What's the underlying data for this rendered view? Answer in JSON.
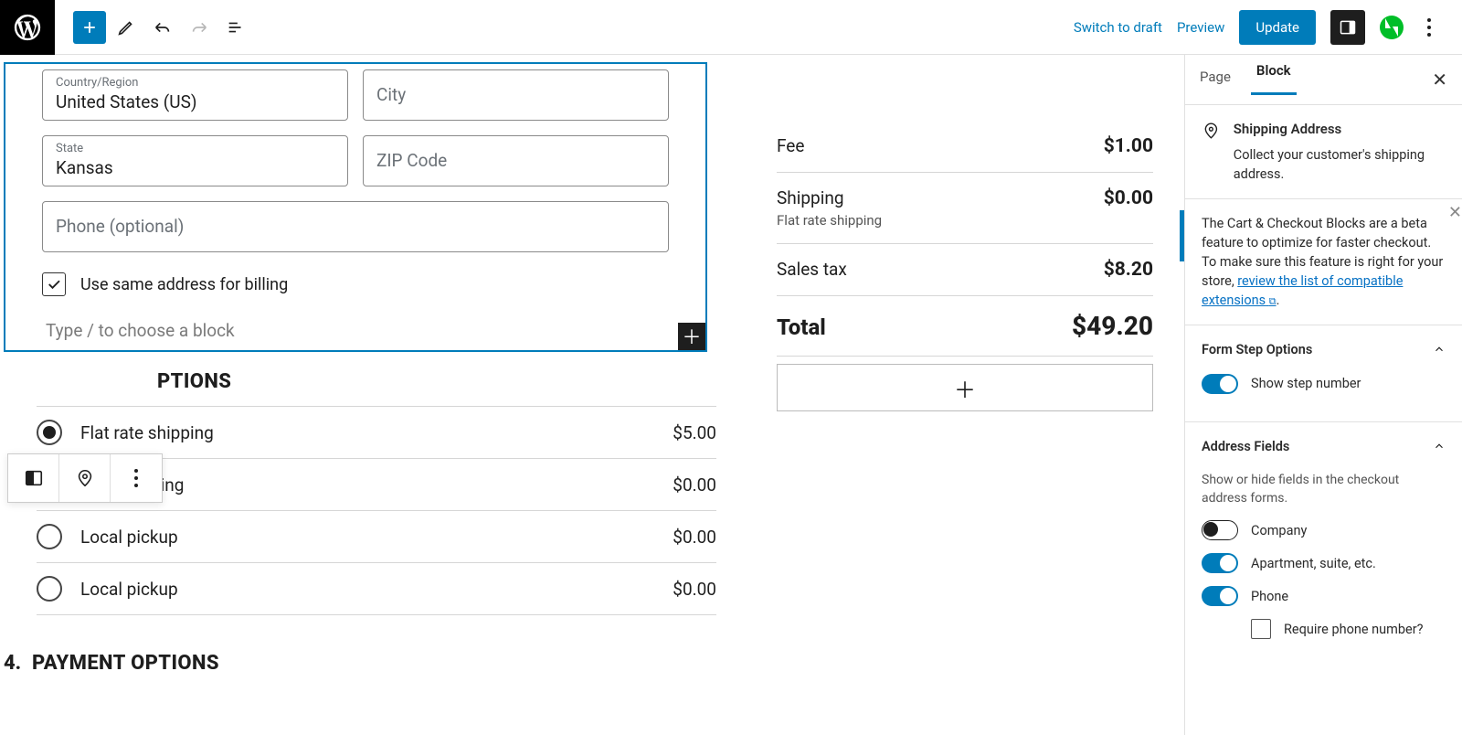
{
  "toolbar": {
    "switch_draft": "Switch to draft",
    "preview": "Preview",
    "update": "Update"
  },
  "address_form": {
    "country_label": "Country/Region",
    "country_value": "United States (US)",
    "city_placeholder": "City",
    "state_label": "State",
    "state_value": "Kansas",
    "zip_placeholder": "ZIP Code",
    "phone_placeholder": "Phone (optional)",
    "same_address": "Use same address for billing",
    "block_prompt": "Type / to choose a block"
  },
  "shipping_opts": {
    "heading_suffix": "PTIONS",
    "rows": [
      {
        "label": "Flat rate shipping",
        "price": "$5.00",
        "selected": true
      },
      {
        "label": "Free shipping",
        "price": "$0.00",
        "selected": false
      },
      {
        "label": "Local pickup",
        "price": "$0.00",
        "selected": false
      },
      {
        "label": "Local pickup",
        "price": "$0.00",
        "selected": false
      }
    ]
  },
  "payment": {
    "number": "4.",
    "heading": "PAYMENT OPTIONS"
  },
  "summary": {
    "fee_label": "Fee",
    "fee_amount": "$1.00",
    "shipping_label": "Shipping",
    "shipping_sub": "Flat rate shipping",
    "shipping_amount": "$0.00",
    "tax_label": "Sales tax",
    "tax_amount": "$8.20",
    "total_label": "Total",
    "total_amount": "$49.20"
  },
  "sidebar": {
    "tab_page": "Page",
    "tab_block": "Block",
    "block_title": "Shipping Address",
    "block_desc": "Collect your customer's shipping address.",
    "notice_text": "The Cart & Checkout Blocks are a beta feature to optimize for faster checkout. To make sure this feature is right for your store, ",
    "notice_link": "review the list of compatible extensions",
    "notice_tail": ".",
    "sec1_title": "Form Step Options",
    "sec1_opt1": "Show step number",
    "sec2_title": "Address Fields",
    "sec2_help": "Show or hide fields in the checkout address forms.",
    "sec2_opt_company": "Company",
    "sec2_opt_apt": "Apartment, suite, etc.",
    "sec2_opt_phone": "Phone",
    "sec2_require_phone": "Require phone number?"
  }
}
